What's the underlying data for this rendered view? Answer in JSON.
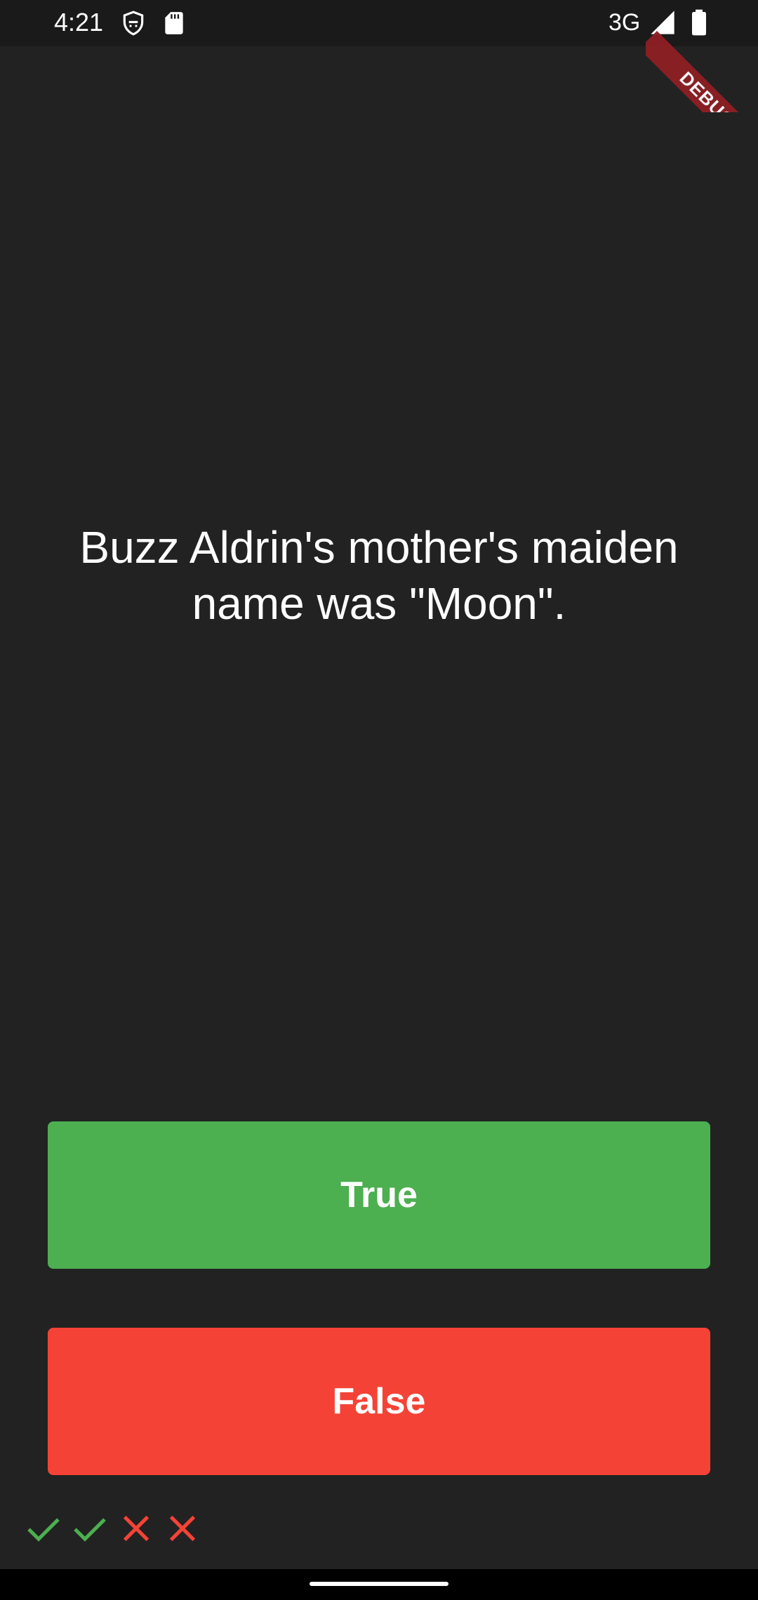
{
  "status_bar": {
    "time": "4:21",
    "network": "3G",
    "icons": [
      "shield-face-icon",
      "sd-card-icon",
      "signal-icon",
      "battery-icon"
    ]
  },
  "debug_banner": {
    "label": "DEBUG"
  },
  "quiz": {
    "question": "Buzz Aldrin's mother's maiden name was \"Moon\".",
    "true_label": "True",
    "false_label": "False"
  },
  "score_keeper": {
    "marks": [
      "check-icon",
      "check-icon",
      "cross-icon",
      "cross-icon"
    ],
    "colors": {
      "correct": "#4caf50",
      "incorrect": "#f44336"
    }
  },
  "theme": {
    "background": "#222222",
    "true_color": "#4caf50",
    "false_color": "#f44336",
    "text_color": "#ffffff"
  }
}
